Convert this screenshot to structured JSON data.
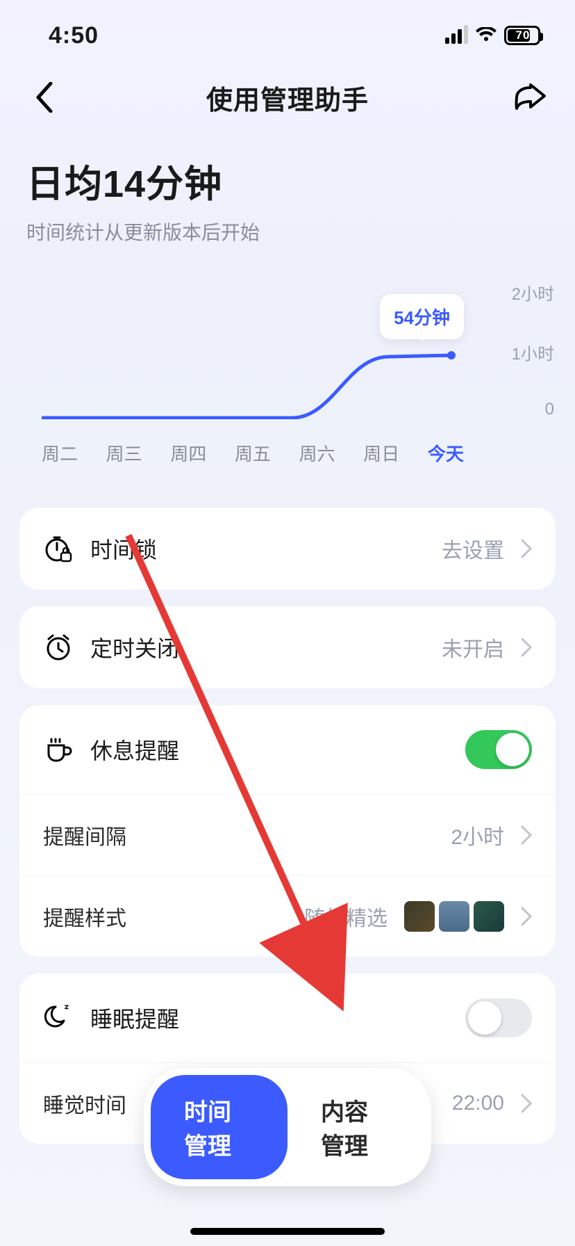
{
  "status": {
    "time": "4:50",
    "battery_pct": "70"
  },
  "nav": {
    "title": "使用管理助手"
  },
  "heading": {
    "title": "日均14分钟",
    "subtitle": "时间统计从更新版本后开始"
  },
  "chart_data": {
    "type": "line",
    "categories": [
      "周二",
      "周三",
      "周四",
      "周五",
      "周六",
      "周日",
      "今天"
    ],
    "values": [
      0,
      0,
      0,
      0,
      0,
      0,
      54
    ],
    "unit": "分钟",
    "ylim": [
      0,
      120
    ],
    "yticks": [
      "2小时",
      "1小时",
      "0"
    ],
    "tooltip": "54分钟",
    "active_index": 6
  },
  "settings": {
    "time_lock": {
      "label": "时间锁",
      "value": "去设置"
    },
    "auto_close": {
      "label": "定时关闭",
      "value": "未开启"
    },
    "rest": {
      "label": "休息提醒",
      "enabled": true,
      "interval": {
        "label": "提醒间隔",
        "value": "2小时"
      },
      "style": {
        "label": "提醒样式",
        "value": "随机精选"
      }
    },
    "sleep": {
      "label": "睡眠提醒",
      "enabled": false,
      "bedtime": {
        "label": "睡觉时间",
        "value": "22:00"
      }
    }
  },
  "tabs": {
    "time": "时间管理",
    "content": "内容管理"
  }
}
